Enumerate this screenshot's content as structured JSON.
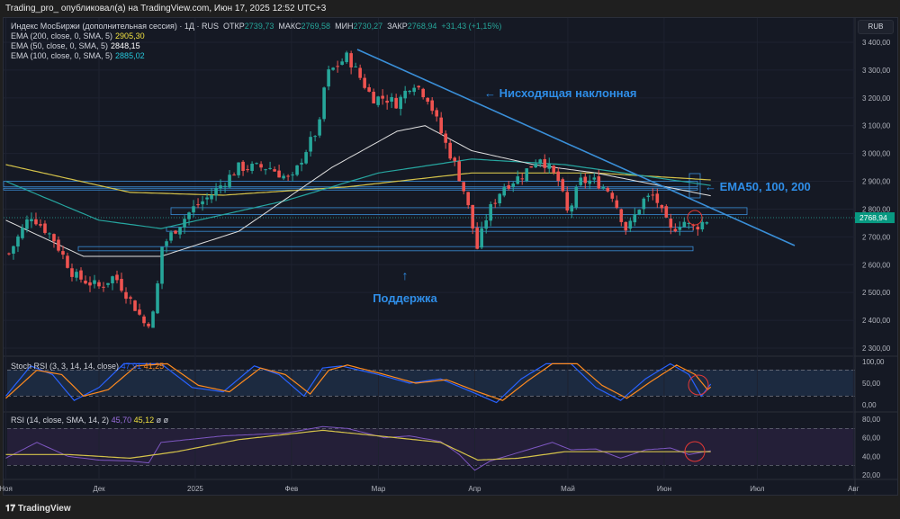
{
  "header": {
    "publisher_line": "Trading_pro_ опубликовал(а) на TradingView.com, Июн 17, 2025 12:52 UTC+3"
  },
  "legend": {
    "symbol": "Индекс МосБиржи (дополнительная сессия) · 1Д · RUS",
    "open_label": "ОТКР",
    "open": "2739,73",
    "high_label": "МАКС",
    "high": "2769,58",
    "low_label": "МИН",
    "low": "2730,27",
    "close_label": "ЗАКР",
    "close": "2768,94",
    "change": "+31,43 (+1,15%)",
    "ema200_label": "EMA (200, close, 0, SMA, 5)",
    "ema200": "2905,30",
    "ema50_label": "EMA (50, close, 0, SMA, 5)",
    "ema50": "2848,15",
    "ema100_label": "EMA (100, close, 0, SMA, 5)",
    "ema100": "2885,02"
  },
  "stoch": {
    "label": "Stoch RSI (3, 3, 14, 14, close)",
    "k": "47,91",
    "d": "41,25"
  },
  "rsi": {
    "label": "RSI (14, close, SMA, 14, 2)",
    "rsi": "45,70",
    "sma": "45,12",
    "extra": "ø ø"
  },
  "currency": "RUB",
  "last_price_label": "2768,94",
  "annotations": {
    "trend": "← Нисходящая наклонная",
    "ema": "← EMA50, 100, 200",
    "support": "Поддержка",
    "support_arrow": "↑"
  },
  "footer": {
    "brand": "TradingView"
  },
  "colors": {
    "up": "#26a69a",
    "down": "#ef5350",
    "ema50": "#e0e0e0",
    "ema100": "#26a6a0",
    "ema200": "#d4c24a",
    "annot": "#2f8ee8"
  },
  "chart_data": {
    "type": "candlestick",
    "price_ticks": [
      "3 400,00",
      "3 300,00",
      "3 200,00",
      "3 100,00",
      "3 000,00",
      "2 900,00",
      "2 800,00",
      "2 700,00",
      "2 600,00",
      "2 500,00",
      "2 400,00",
      "2 300,00"
    ],
    "price_values": [
      3400,
      3300,
      3200,
      3100,
      3000,
      2900,
      2800,
      2700,
      2600,
      2500,
      2400,
      2300
    ],
    "ylim": [
      2240,
      3440
    ],
    "time_labels": [
      "Ноя",
      "Дек",
      "2025",
      "Фев",
      "Мар",
      "Апр",
      "Май",
      "Июн",
      "Июл",
      "Авг"
    ],
    "time_positions_days": [
      -30,
      0,
      31,
      62,
      90,
      121,
      151,
      182,
      212,
      243
    ],
    "close_keyframes_day": [
      -29,
      -22,
      -15,
      -8,
      0,
      5,
      12,
      15,
      18,
      20,
      24,
      30,
      36,
      45,
      55,
      62,
      66,
      71,
      73,
      75,
      80,
      88,
      92,
      96,
      101,
      106,
      111,
      115,
      118,
      122,
      124,
      126,
      130,
      136,
      142,
      148,
      151,
      155,
      160,
      165,
      170,
      175,
      179,
      181,
      184,
      188,
      191,
      197
    ],
    "close_keyframes": [
      2640,
      2780,
      2700,
      2560,
      2520,
      2560,
      2440,
      2380,
      2430,
      2660,
      2720,
      2800,
      2850,
      2950,
      2950,
      2900,
      3000,
      3100,
      3280,
      3300,
      3350,
      3200,
      3200,
      3180,
      3260,
      3200,
      3050,
      2950,
      2850,
      2650,
      2750,
      2800,
      2880,
      2920,
      2990,
      2900,
      2780,
      2900,
      2900,
      2860,
      2720,
      2830,
      2850,
      2790,
      2720,
      2760,
      2730,
      2769
    ],
    "ema50_keys": [
      [
        -30,
        2760
      ],
      [
        -5,
        2630
      ],
      [
        20,
        2630
      ],
      [
        45,
        2720
      ],
      [
        75,
        2950
      ],
      [
        96,
        3080
      ],
      [
        105,
        3100
      ],
      [
        120,
        3010
      ],
      [
        140,
        2960
      ],
      [
        160,
        2930
      ],
      [
        197,
        2848
      ]
    ],
    "ema100_keys": [
      [
        -30,
        2900
      ],
      [
        0,
        2760
      ],
      [
        20,
        2730
      ],
      [
        60,
        2830
      ],
      [
        90,
        2930
      ],
      [
        120,
        2980
      ],
      [
        150,
        2960
      ],
      [
        197,
        2885
      ]
    ],
    "ema200_keys": [
      [
        -30,
        2960
      ],
      [
        10,
        2860
      ],
      [
        40,
        2850
      ],
      [
        80,
        2880
      ],
      [
        120,
        2930
      ],
      [
        160,
        2930
      ],
      [
        197,
        2905
      ]
    ],
    "stoch_k_keys": [
      [
        -30,
        20
      ],
      [
        -22,
        90
      ],
      [
        -15,
        70
      ],
      [
        -8,
        10
      ],
      [
        0,
        40
      ],
      [
        8,
        95
      ],
      [
        20,
        95
      ],
      [
        30,
        40
      ],
      [
        40,
        30
      ],
      [
        50,
        90
      ],
      [
        58,
        70
      ],
      [
        66,
        20
      ],
      [
        72,
        85
      ],
      [
        78,
        90
      ],
      [
        90,
        70
      ],
      [
        100,
        50
      ],
      [
        110,
        60
      ],
      [
        120,
        30
      ],
      [
        128,
        5
      ],
      [
        136,
        60
      ],
      [
        144,
        95
      ],
      [
        152,
        95
      ],
      [
        160,
        40
      ],
      [
        168,
        10
      ],
      [
        176,
        60
      ],
      [
        184,
        95
      ],
      [
        190,
        70
      ],
      [
        194,
        20
      ],
      [
        197,
        48
      ]
    ],
    "stoch_d_keys": [
      [
        -30,
        15
      ],
      [
        -20,
        80
      ],
      [
        -12,
        70
      ],
      [
        -5,
        20
      ],
      [
        3,
        35
      ],
      [
        12,
        90
      ],
      [
        22,
        95
      ],
      [
        32,
        45
      ],
      [
        42,
        30
      ],
      [
        52,
        85
      ],
      [
        60,
        70
      ],
      [
        68,
        25
      ],
      [
        74,
        80
      ],
      [
        80,
        92
      ],
      [
        92,
        70
      ],
      [
        102,
        50
      ],
      [
        112,
        58
      ],
      [
        122,
        30
      ],
      [
        130,
        10
      ],
      [
        138,
        55
      ],
      [
        146,
        95
      ],
      [
        154,
        95
      ],
      [
        162,
        45
      ],
      [
        170,
        15
      ],
      [
        178,
        55
      ],
      [
        186,
        92
      ],
      [
        192,
        70
      ],
      [
        196,
        35
      ],
      [
        197,
        41
      ]
    ],
    "rsi_keys": [
      [
        -30,
        38
      ],
      [
        -20,
        55
      ],
      [
        -10,
        40
      ],
      [
        0,
        36
      ],
      [
        10,
        35
      ],
      [
        16,
        33
      ],
      [
        20,
        55
      ],
      [
        40,
        62
      ],
      [
        60,
        65
      ],
      [
        72,
        72
      ],
      [
        80,
        70
      ],
      [
        92,
        60
      ],
      [
        100,
        62
      ],
      [
        110,
        56
      ],
      [
        116,
        42
      ],
      [
        121,
        25
      ],
      [
        126,
        35
      ],
      [
        136,
        45
      ],
      [
        146,
        55
      ],
      [
        152,
        47
      ],
      [
        160,
        48
      ],
      [
        168,
        38
      ],
      [
        176,
        47
      ],
      [
        184,
        49
      ],
      [
        190,
        42
      ],
      [
        197,
        46
      ]
    ],
    "rsi_sma_keys": [
      [
        -30,
        42
      ],
      [
        -10,
        42
      ],
      [
        10,
        38
      ],
      [
        25,
        45
      ],
      [
        45,
        58
      ],
      [
        72,
        68
      ],
      [
        90,
        62
      ],
      [
        110,
        55
      ],
      [
        122,
        36
      ],
      [
        135,
        38
      ],
      [
        150,
        45
      ],
      [
        170,
        45
      ],
      [
        197,
        45
      ]
    ]
  }
}
